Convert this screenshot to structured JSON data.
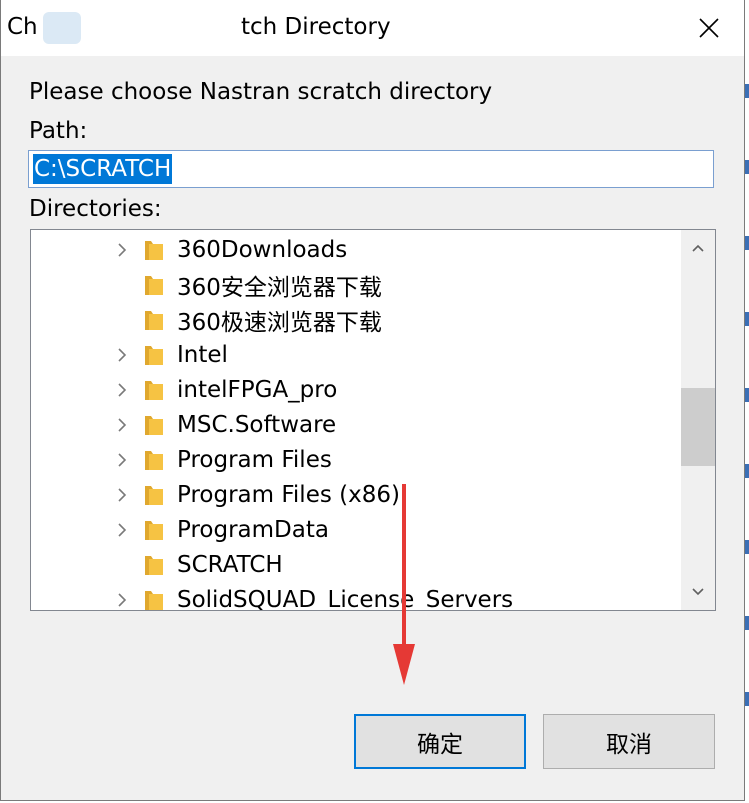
{
  "window": {
    "title_visible_start": "Ch",
    "title_visible_end": "tch Directory"
  },
  "dialog": {
    "prompt": "Please choose Nastran scratch directory",
    "path_label": "Path:",
    "path_value": "C:\\SCRATCH",
    "directories_label": "Directories:"
  },
  "tree": {
    "items": [
      {
        "label": "360Downloads",
        "expandable": true
      },
      {
        "label": "360安全浏览器下载",
        "expandable": false
      },
      {
        "label": "360极速浏览器下载",
        "expandable": false
      },
      {
        "label": "Intel",
        "expandable": true
      },
      {
        "label": "intelFPGA_pro",
        "expandable": true
      },
      {
        "label": "MSC.Software",
        "expandable": true
      },
      {
        "label": "Program Files",
        "expandable": true
      },
      {
        "label": "Program Files (x86)",
        "expandable": true
      },
      {
        "label": "ProgramData",
        "expandable": true
      },
      {
        "label": "SCRATCH",
        "expandable": false
      },
      {
        "label": "SolidSQUAD_License_Servers",
        "expandable": true
      }
    ]
  },
  "buttons": {
    "ok_label": "确定",
    "cancel_label": "取消"
  },
  "colors": {
    "selection": "#0078d7",
    "folder": "#f6c343",
    "annotation_arrow": "#e53935"
  }
}
